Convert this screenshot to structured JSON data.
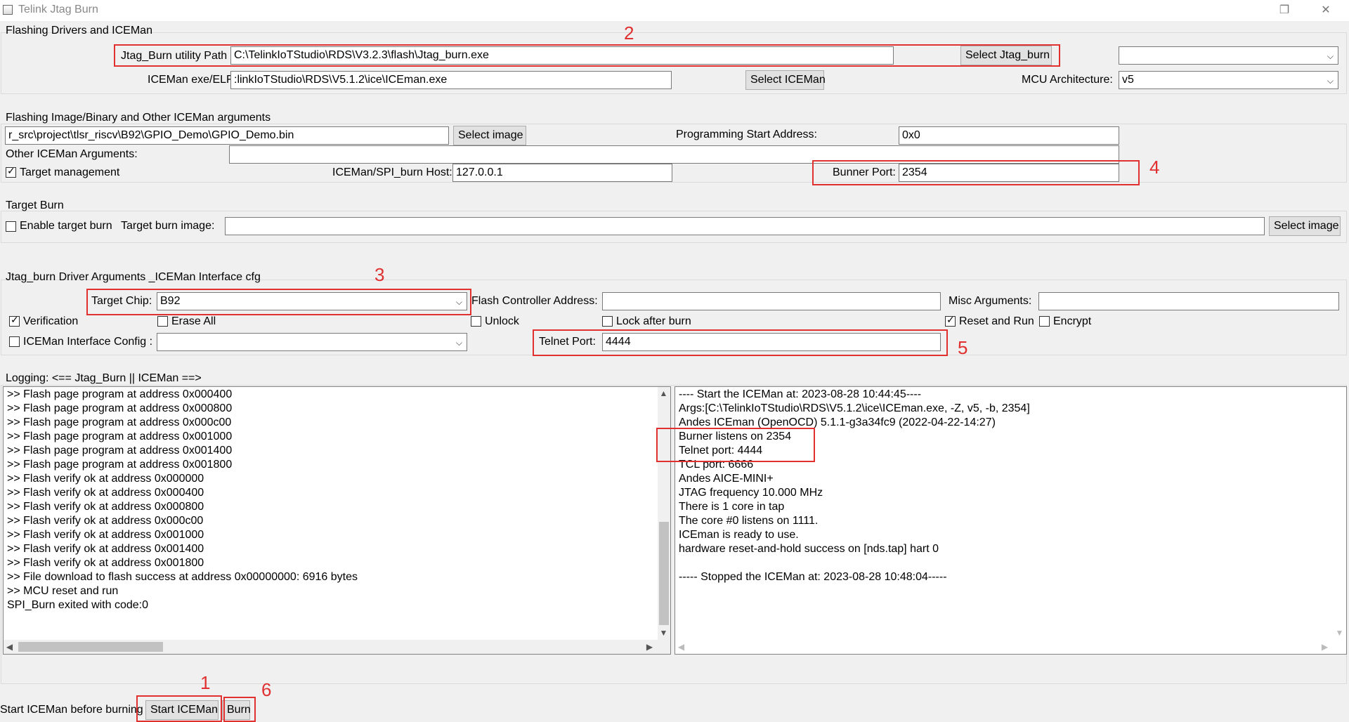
{
  "window": {
    "title": "Telink Jtag Burn",
    "restore_glyph": "❐",
    "close_glyph": "✕"
  },
  "drivers_group": {
    "title": "Flashing Drivers and ICEMan",
    "jtag_path_label": "Jtag_Burn utility Path",
    "jtag_path_value": "C:\\TelinkIoTStudio\\RDS\\V3.2.3\\flash\\Jtag_burn.exe",
    "select_jtag_button": "Select Jtag_burn",
    "top_right_combo_value": "",
    "iceman_label": "ICEMan exe/ELF",
    "iceman_value": ":linkIoTStudio\\RDS\\V5.1.2\\ice\\ICEman.exe",
    "select_iceman_button": "Select ICEMan",
    "mcu_arch_label": "MCU Architecture:",
    "mcu_arch_value": "v5"
  },
  "image_group": {
    "title": "Flashing Image/Binary and Other ICEMan arguments",
    "image_path_value": "r_src\\project\\tlsr_riscv\\B92\\GPIO_Demo\\GPIO_Demo.bin",
    "select_image_button": "Select image",
    "start_address_label": "Programming Start Address:",
    "start_address_value": "0x0",
    "other_args_label": "Other ICEMan Arguments:",
    "other_args_value": "",
    "target_mgmt_label": "Target management",
    "host_label": "ICEMan/SPI_burn Host:",
    "host_value": "127.0.0.1",
    "burner_port_label": "Bunner Port:",
    "burner_port_value": "2354"
  },
  "target_burn_group": {
    "title": "Target Burn",
    "enable_label": "Enable target burn",
    "image_label": "Target burn image:",
    "image_value": "",
    "select_image_button": "Select image"
  },
  "driver_args_group": {
    "title": "Jtag_burn Driver Arguments _ICEMan Interface cfg",
    "target_chip_label": "Target Chip:",
    "target_chip_value": "B92",
    "flash_ctrl_label": "Flash Controller Address:",
    "flash_ctrl_value": "",
    "misc_label": "Misc Arguments:",
    "misc_value": "",
    "verification_label": "Verification",
    "erase_all_label": "Erase All",
    "unlock_label": "Unlock",
    "lock_after_label": "Lock after burn",
    "reset_run_label": "Reset and Run",
    "encrypt_label": "Encrypt",
    "iceman_if_label": "ICEMan Interface Config :",
    "iceman_if_value": "",
    "telnet_label": "Telnet Port:",
    "telnet_value": "4444"
  },
  "logging": {
    "title": "Logging: <== Jtag_Burn || ICEMan ==>",
    "left_lines": [
      ">> Flash page program at address 0x000400",
      ">> Flash page program at address 0x000800",
      ">> Flash page program at address 0x000c00",
      ">> Flash page program at address 0x001000",
      ">> Flash page program at address 0x001400",
      ">> Flash page program at address 0x001800",
      ">> Flash verify ok at address 0x000000",
      ">> Flash verify ok at address 0x000400",
      ">> Flash verify ok at address 0x000800",
      ">> Flash verify ok at address 0x000c00",
      ">> Flash verify ok at address 0x001000",
      ">> Flash verify ok at address 0x001400",
      ">> Flash verify ok at address 0x001800",
      ">> File download to flash success at address 0x00000000: 6916 bytes",
      ">> MCU reset and run",
      "SPI_Burn exited with code:0"
    ],
    "right_lines": [
      "---- Start the ICEMan at: 2023-08-28 10:44:45----",
      "Args:[C:\\TelinkIoTStudio\\RDS\\V5.1.2\\ice\\ICEman.exe, -Z, v5, -b, 2354]",
      "Andes ICEman (OpenOCD) 5.1.1-g3a34fc9 (2022-04-22-14:27)",
      "Burner listens on 2354",
      "Telnet port: 4444",
      "TCL port: 6666",
      "Andes AICE-MINI+",
      "JTAG frequency 10.000 MHz",
      "There is 1 core in tap",
      "The core #0 listens on 1111.",
      "ICEman is ready to use.",
      "hardware reset-and-hold success on [nds.tap] hart 0",
      "",
      "----- Stopped the ICEMan at: 2023-08-28 10:48:04-----"
    ]
  },
  "bottom": {
    "hint_label": "Start ICEMan before burning",
    "start_iceman_button": "Start ICEMan",
    "burn_button": "Burn"
  },
  "annotations": {
    "n1": "1",
    "n2": "2",
    "n3": "3",
    "n4": "4",
    "n5": "5",
    "n6": "6",
    "color": "#e03030"
  }
}
